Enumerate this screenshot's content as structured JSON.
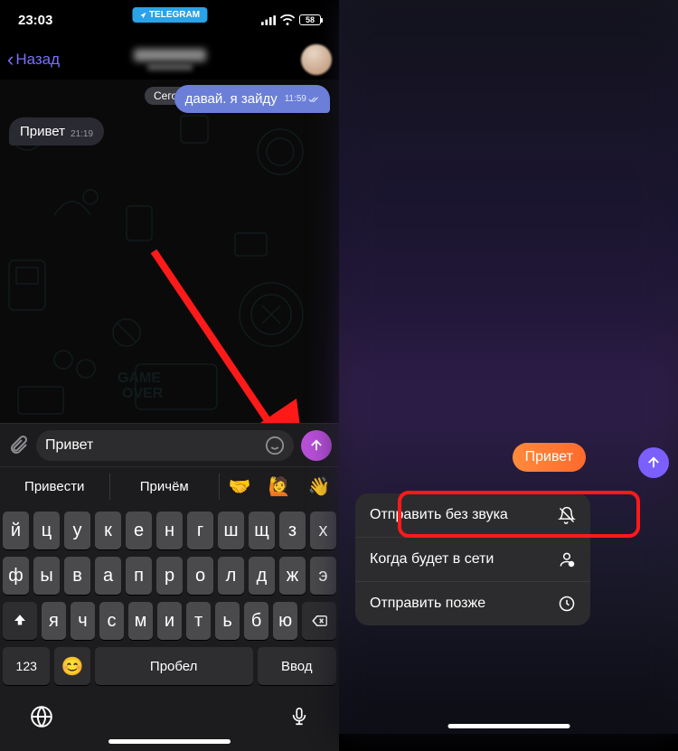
{
  "left": {
    "status": {
      "time": "23:03",
      "center_badge": "TELEGRAM",
      "battery": "58"
    },
    "nav": {
      "back_label": "Назад"
    },
    "chat": {
      "date_label": "Сегодня",
      "msg_out": {
        "text": "давай. я зайду",
        "time": "11:59"
      },
      "msg_in": {
        "text": "Привет",
        "time": "21:19"
      }
    },
    "input": {
      "value": "Привет"
    },
    "suggestions": {
      "word1": "Привести",
      "word2": "Причём",
      "emoji1": "🤝",
      "emoji2": "🙋",
      "emoji3": "👋"
    },
    "keyboard": {
      "row1": [
        "й",
        "ц",
        "у",
        "к",
        "е",
        "н",
        "г",
        "ш",
        "щ",
        "з",
        "х"
      ],
      "row2": [
        "ф",
        "ы",
        "в",
        "а",
        "п",
        "р",
        "о",
        "л",
        "д",
        "ж",
        "э"
      ],
      "row3": [
        "я",
        "ч",
        "с",
        "м",
        "и",
        "т",
        "ь",
        "б",
        "ю"
      ],
      "num_label": "123",
      "space_label": "Пробел",
      "return_label": "Ввод"
    }
  },
  "right": {
    "message": "Привет",
    "menu": {
      "item1": "Отправить без звука",
      "item2": "Когда будет в сети",
      "item3": "Отправить позже"
    }
  }
}
